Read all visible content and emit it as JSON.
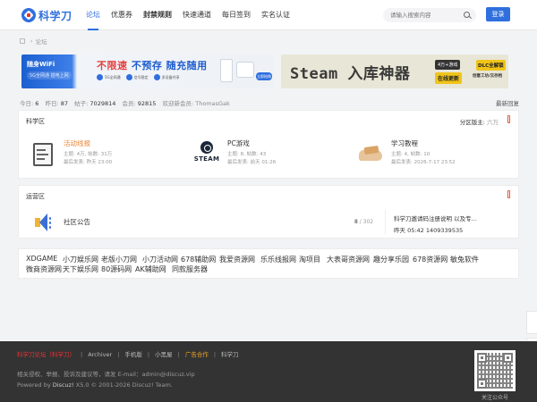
{
  "header": {
    "logo_text": "科学刀",
    "nav": [
      "论坛",
      "优惠券",
      "封禁规则",
      "快速通道",
      "每日签到",
      "实名认证"
    ],
    "search_placeholder": "请输入搜索内容",
    "login": "登录"
  },
  "breadcrumb": {
    "sep": "›",
    "current": "论坛"
  },
  "banners": {
    "wifi": {
      "brand": "随身WiFi",
      "sub": "5G全网通 插电上网",
      "head_a": "不限速 ",
      "head_b": "不预存 随充随用",
      "feats": [
        "5G全网通",
        "信号稳定",
        "多设备共享"
      ],
      "cta": "立即抢购"
    },
    "steam": {
      "head": "Steam 入库神器",
      "tag1": "4万+游戏",
      "tag2": "在线更新",
      "tag3": "DLC全解锁",
      "tag4": "创意工坊/云存档"
    }
  },
  "stats": {
    "today_label": "今日:",
    "today": "6",
    "yesterday_label": "昨日:",
    "yesterday": "87",
    "posts_label": "帖子:",
    "posts": "7029814",
    "members_label": "会员:",
    "members": "92815",
    "welcome": "欢迎新会员: ThomasGak",
    "latest": "最新回复"
  },
  "sections": [
    {
      "title": "科学区",
      "moderator_label": "分区版主:",
      "moderator": "六万",
      "forums": [
        {
          "name": "活动线报",
          "meta": "主题: 4万,  帖数: 31万",
          "last": "最后发表: 昨天 23:00",
          "icon": "document-icon"
        },
        {
          "name": "PC游戏",
          "meta": "主题: 8,  帖数: 43",
          "last": "最后发表: 前天 01:26",
          "icon": "steam-icon",
          "icon_text": "STEAM"
        },
        {
          "name": "学习教程",
          "meta": "主题: 4,  帖数: 10",
          "last": "最后发表: 2026-7-17 23:52",
          "icon": "learning-icon"
        }
      ]
    },
    {
      "title": "运营区",
      "forums": [
        {
          "name": "社区公告",
          "count_a": "8",
          "count_sep": " / ",
          "count_b": "302",
          "last_title": "科学刀邀请码注册说明 以及专...",
          "last_time": "昨天 05:42 1409339535",
          "icon": "speaker-icon"
        }
      ]
    }
  ],
  "links": {
    "row1": [
      "XDGAME",
      "小刀娱乐网",
      "老版小刀网",
      "小刀活动网",
      "678辅助网",
      "我爱资源网",
      "乐乐线报网",
      "淘项目",
      "大表哥资源网",
      "趣分享乐园",
      "678资源网",
      "敏兔软件"
    ],
    "row2": [
      "微商资源网",
      "天下娱乐网",
      "80源码网",
      "AK辅助网",
      "同款服务器"
    ]
  },
  "footer": {
    "links": [
      "科学刀论坛（科学刀）",
      "Archiver",
      "手机版",
      "小黑屋",
      "广告合作",
      "科学刀"
    ],
    "contact": "相关侵权、举报、投诉及建议等，请发 E-mail：admin@discuz.vip",
    "powered_prefix": "Powered by ",
    "powered_name": "Discuz!",
    "powered_suffix": " X5.0 © 2001-2026 Discuz! Team.",
    "qr_label": "关注公众号"
  },
  "colors": {
    "accent": "#2f6fde",
    "hot": "#e8883a",
    "footer_bg": "#333333"
  }
}
